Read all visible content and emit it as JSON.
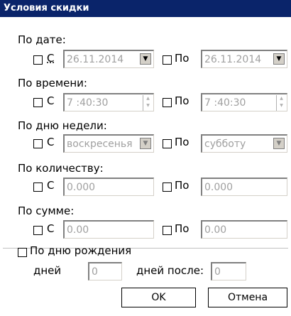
{
  "window": {
    "title": "Условия скидки"
  },
  "by_date": {
    "label": "По дате:",
    "from_label": "С",
    "to_label": "По",
    "from_value": "26.11.2014",
    "to_value": "26.11.2014",
    "from_checked": false,
    "to_checked": false
  },
  "by_time": {
    "label": "По времени:",
    "from_label": "С",
    "to_label": "По",
    "from_value": "7 :40:30",
    "to_value": "7 :40:30"
  },
  "by_weekday": {
    "label": "По дню недели:",
    "from_label": "С",
    "to_label": "По",
    "from_value": "воскресенья",
    "to_value": "субботу"
  },
  "by_quantity": {
    "label": "По количеству:",
    "from_label": "С",
    "to_label": "По",
    "from_value": "0.000",
    "to_value": "0.000"
  },
  "by_sum": {
    "label": "По сумме:",
    "from_label": "С",
    "to_label": "По",
    "from_value": "0.00",
    "to_value": "0.00"
  },
  "by_birthday": {
    "label": "По дню рождения",
    "days_label": "дней",
    "days_value": "0",
    "days_after_label": "дней после:",
    "days_after_value": "0"
  },
  "buttons": {
    "ok": "OK",
    "cancel": "Отмена"
  },
  "colors": {
    "titlebar": "#0a246a",
    "disabled_text": "#a0a0a0"
  }
}
